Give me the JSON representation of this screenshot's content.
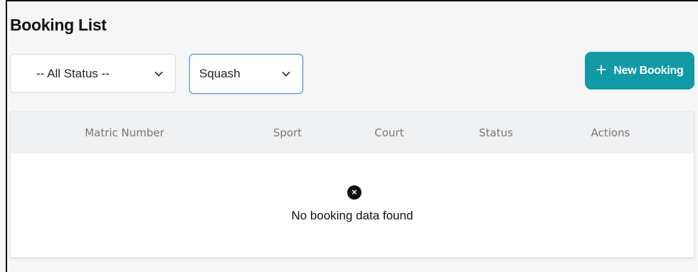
{
  "page": {
    "title": "Booking List"
  },
  "filters": {
    "status": {
      "value": "-- All Status --",
      "icon": "chevron-down-icon"
    },
    "sport": {
      "value": "Squash",
      "icon": "chevron-down-icon"
    }
  },
  "actions": {
    "new_booking_label": "New Booking",
    "new_booking_icon": "plus-icon"
  },
  "table": {
    "columns": [
      "Matric Number",
      "Sport",
      "Court",
      "Status",
      "Actions"
    ],
    "rows": [],
    "empty": {
      "icon": "close-circle-icon",
      "message": "No booking data found"
    }
  },
  "colors": {
    "accent": "#119aa6",
    "focus_border": "#5b8ed6",
    "header_bg": "#f0f1f3"
  }
}
